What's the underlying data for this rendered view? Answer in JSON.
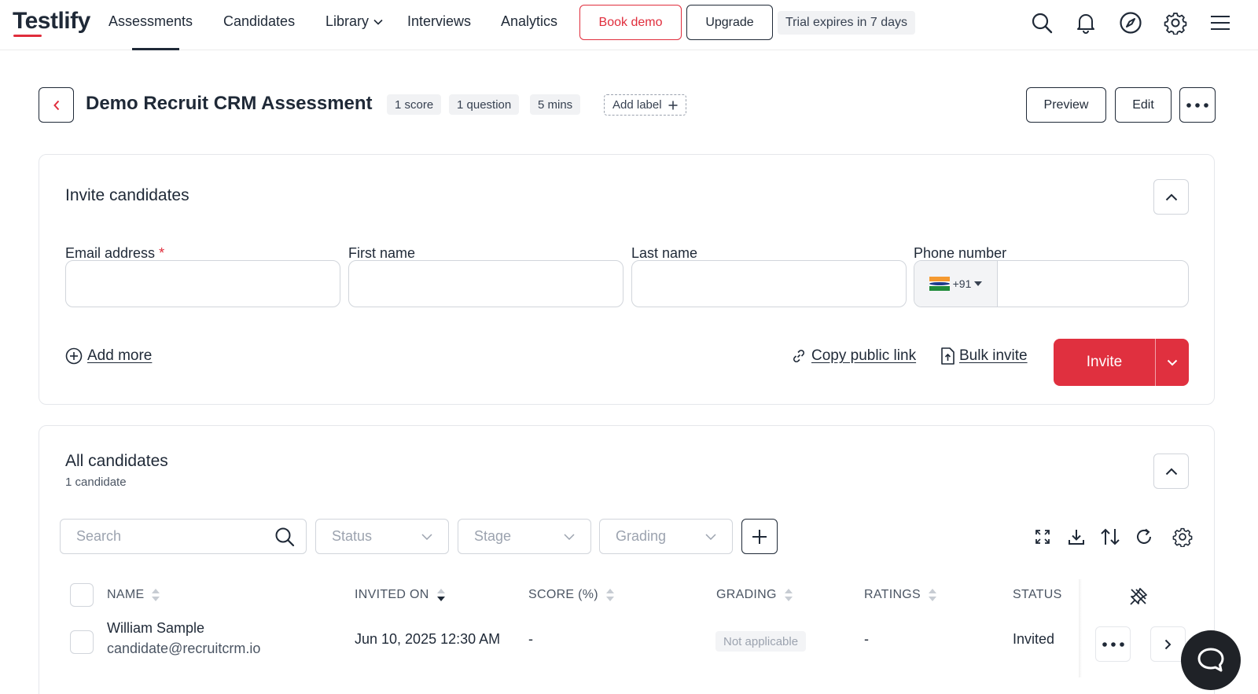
{
  "app": {
    "logo": "Testlify",
    "brand_color": "#e02d3c"
  },
  "nav": {
    "links": [
      "Assessments",
      "Candidates",
      "Library",
      "Interviews",
      "Analytics"
    ],
    "book_demo": "Book demo",
    "upgrade": "Upgrade",
    "trial": "Trial expires in 7 days",
    "icons": [
      "search-icon",
      "bell-icon",
      "compass-icon",
      "gear-icon",
      "menu-icon"
    ]
  },
  "header": {
    "title": "Demo Recruit CRM Assessment",
    "chips": [
      "1 score",
      "1 question",
      "5 mins"
    ],
    "add_label": "Add label",
    "preview": "Preview",
    "edit": "Edit"
  },
  "invite": {
    "title": "Invite candidates",
    "fields": {
      "email": {
        "label": "Email address",
        "required_mark": "*",
        "value": ""
      },
      "first_name": {
        "label": "First name",
        "value": ""
      },
      "last_name": {
        "label": "Last name",
        "value": ""
      },
      "phone": {
        "label": "Phone number",
        "country_code": "+91",
        "value": ""
      }
    },
    "add_more": "Add more",
    "copy_link": "Copy public link",
    "bulk_invite": "Bulk invite",
    "invite_button": "Invite"
  },
  "candidates": {
    "title": "All candidates",
    "count": "1 candidate",
    "search_placeholder": "Search",
    "filters": [
      "Status",
      "Stage",
      "Grading"
    ],
    "columns": [
      "NAME",
      "INVITED ON",
      "SCORE (%)",
      "GRADING",
      "RATINGS",
      "STATUS"
    ],
    "rows": [
      {
        "name": "William Sample",
        "email": "candidate@recruitcrm.io",
        "invited_on": "Jun 10, 2025 12:30 AM",
        "score": "-",
        "grading": "Not applicable",
        "ratings": "-",
        "status": "Invited"
      }
    ]
  }
}
